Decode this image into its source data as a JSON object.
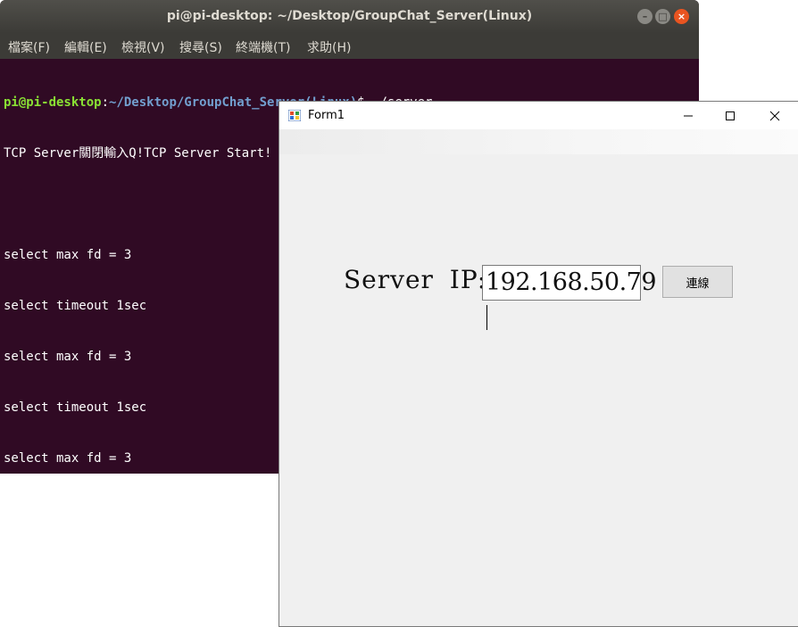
{
  "terminal": {
    "title": "pi@pi-desktop: ~/Desktop/GroupChat_Server(Linux)",
    "menu": [
      "檔案(F)",
      "編輯(E)",
      "檢視(V)",
      "搜尋(S)",
      "終端機(T)",
      "求助(H)"
    ],
    "prompt_user": "pi@pi-desktop",
    "prompt_sep": ":",
    "prompt_path": "~/Desktop/GroupChat_Server(Linux)",
    "prompt_cmd": "$ ./server",
    "lines": [
      "TCP Server關閉輸入Q!TCP Server Start!",
      "",
      "select max fd = 3",
      "select timeout 1sec",
      "select max fd = 3",
      "select timeout 1sec",
      "select max fd = 3"
    ],
    "colors": {
      "background": "#300a24",
      "user": "#8ae234",
      "path": "#729fcf",
      "close_button": "#e95420"
    }
  },
  "form": {
    "caption": "Form1",
    "ip_label": "Server IP:",
    "ip_value": "192.168.50.79",
    "connect_label": "連線",
    "colors": {
      "background": "#f0f0f0"
    }
  }
}
